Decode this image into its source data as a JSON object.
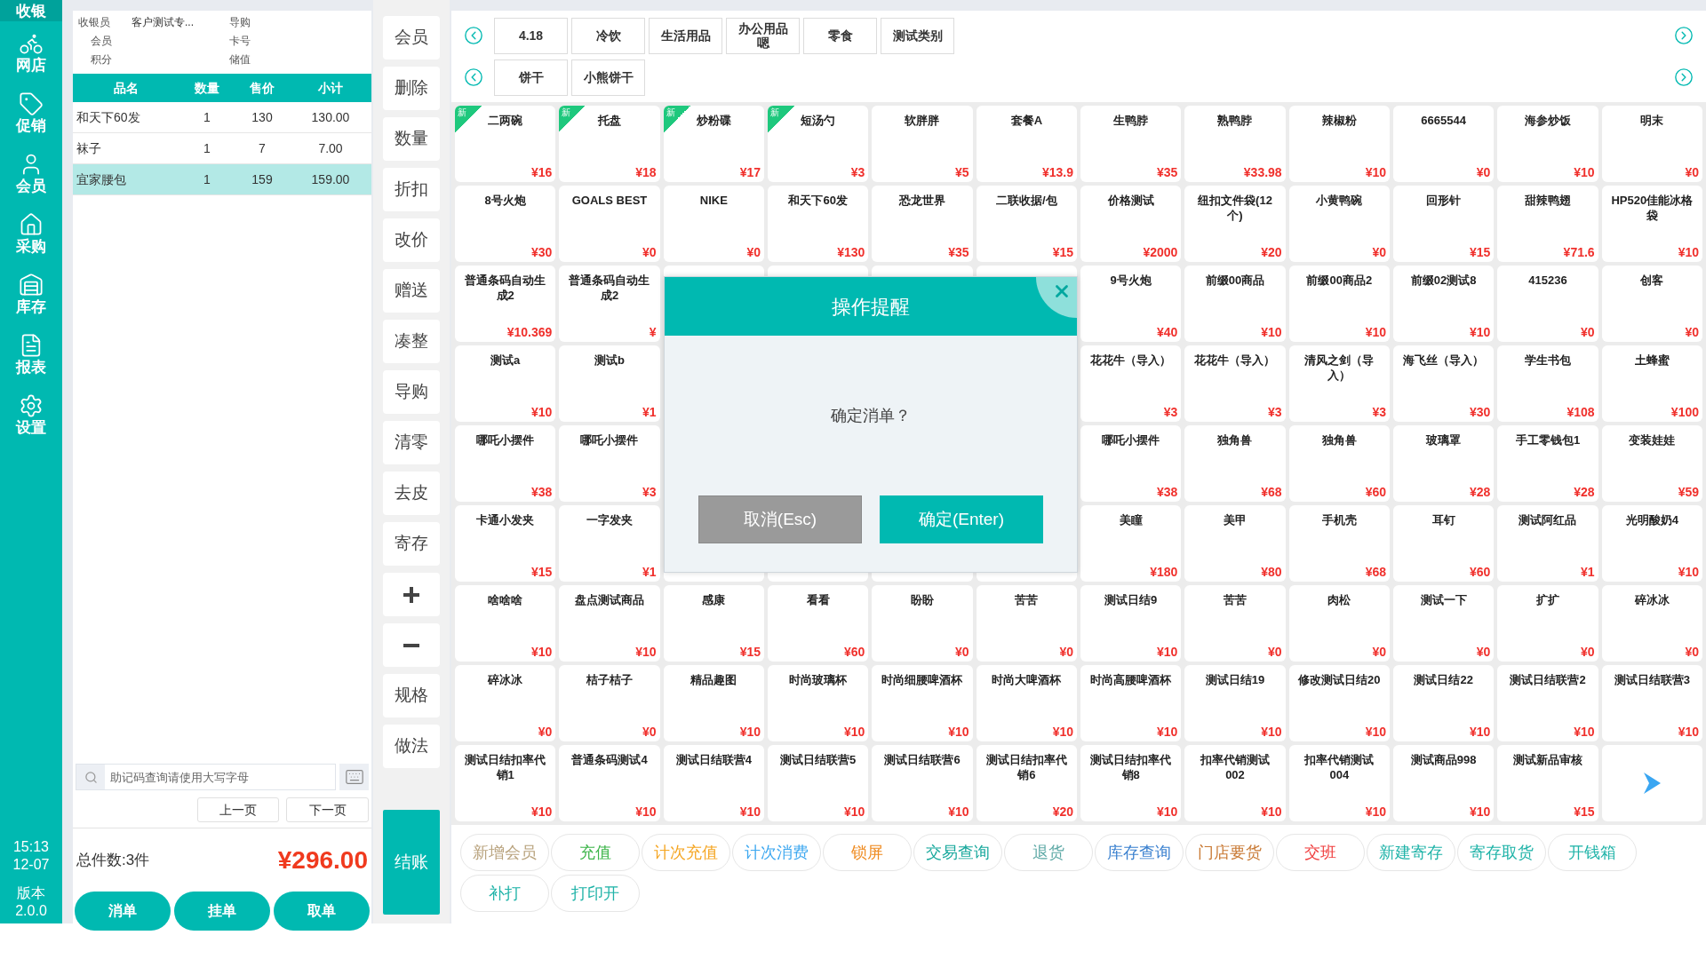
{
  "sidebar": {
    "items": [
      {
        "label": "收银",
        "selected": true
      },
      {
        "label": "网店",
        "selected": false
      },
      {
        "label": "促销",
        "selected": false
      },
      {
        "label": "会员",
        "selected": false
      },
      {
        "label": "采购",
        "selected": false
      },
      {
        "label": "库存",
        "selected": false
      },
      {
        "label": "报表",
        "selected": false
      },
      {
        "label": "设置",
        "selected": false
      }
    ],
    "time": "15:13",
    "date": "12-07",
    "version_label": "版本",
    "version": "2.0.0"
  },
  "order": {
    "info_rows": [
      {
        "left_label": "收银员",
        "left_value": "客户测试专...",
        "right_label": "导购"
      },
      {
        "left_label": "会员",
        "right_label": "卡号"
      },
      {
        "left_label": "积分",
        "right_label": "储值"
      }
    ],
    "columns": [
      "品名",
      "数量",
      "售价",
      "小计"
    ],
    "rows": [
      {
        "name": "和天下60发",
        "qty": "1",
        "price": "130",
        "subtotal": "130.00",
        "selected": false
      },
      {
        "name": "袜子",
        "qty": "1",
        "price": "7",
        "subtotal": "7.00",
        "selected": false
      },
      {
        "name": "宜家腰包",
        "qty": "1",
        "price": "159",
        "subtotal": "159.00",
        "selected": true
      }
    ],
    "search": {
      "placeholder": "助记码查询请使用大写字母"
    },
    "prev_page": "上一页",
    "next_page": "下一页",
    "total_count": "总件数:3件",
    "total_amount": "¥296.00",
    "buttons": [
      "消单",
      "挂单",
      "取单"
    ]
  },
  "functions": [
    {
      "kind": "text",
      "label": "会员"
    },
    {
      "kind": "text",
      "label": "删除"
    },
    {
      "kind": "text",
      "label": "数量"
    },
    {
      "kind": "text",
      "label": "折扣"
    },
    {
      "kind": "text",
      "label": "改价"
    },
    {
      "kind": "text",
      "label": "赠送"
    },
    {
      "kind": "text",
      "label": "凑整"
    },
    {
      "kind": "text",
      "label": "导购"
    },
    {
      "kind": "text",
      "label": "清零"
    },
    {
      "kind": "text",
      "label": "去皮"
    },
    {
      "kind": "text",
      "label": "寄存"
    },
    {
      "kind": "plus"
    },
    {
      "kind": "minus"
    },
    {
      "kind": "text",
      "label": "规格"
    },
    {
      "kind": "text",
      "label": "做法"
    }
  ],
  "checkout": "结账",
  "category_rows": [
    [
      "4.18",
      "冷饮",
      "生活用品",
      "办公用品嗯",
      "零食",
      "测试类别"
    ],
    [
      "饼干",
      "小熊饼干"
    ]
  ],
  "products": [
    {
      "kind": "product",
      "name": "二两碗",
      "price": "¥16",
      "new": true,
      "badge": "新"
    },
    {
      "kind": "product",
      "name": "托盘",
      "price": "¥18",
      "new": true,
      "badge": "新"
    },
    {
      "kind": "product",
      "name": "炒粉碟",
      "price": "¥17",
      "new": true,
      "badge": "新"
    },
    {
      "kind": "product",
      "name": "短汤勺",
      "price": "¥3",
      "new": true,
      "badge": "新"
    },
    {
      "kind": "product",
      "name": "软胖胖",
      "price": "¥5",
      "new": false
    },
    {
      "kind": "product",
      "name": "套餐A",
      "price": "¥13.9",
      "new": false
    },
    {
      "kind": "product",
      "name": "生鸭脖",
      "price": "¥35",
      "new": false
    },
    {
      "kind": "product",
      "name": "熟鸭脖",
      "price": "¥33.98",
      "new": false
    },
    {
      "kind": "product",
      "name": "辣椒粉",
      "price": "¥10",
      "new": false
    },
    {
      "kind": "product",
      "name": "6665544",
      "price": "¥0",
      "new": false
    },
    {
      "kind": "product",
      "name": "海参炒饭",
      "price": "¥10",
      "new": false
    },
    {
      "kind": "product",
      "name": "明末",
      "price": "¥0",
      "new": false
    },
    {
      "kind": "product",
      "name": "8号火炮",
      "price": "¥30",
      "new": false
    },
    {
      "kind": "product",
      "name": "GOALS BEST",
      "price": "¥0",
      "new": false
    },
    {
      "kind": "product",
      "name": "NIKE",
      "price": "¥0",
      "new": false
    },
    {
      "kind": "product",
      "name": "和天下60发",
      "price": "¥130",
      "new": false
    },
    {
      "kind": "product",
      "name": "恐龙世界",
      "price": "¥35",
      "new": false
    },
    {
      "kind": "product",
      "name": "二联收据/包",
      "price": "¥15",
      "new": false
    },
    {
      "kind": "product",
      "name": "价格测试",
      "price": "¥2000",
      "new": false
    },
    {
      "kind": "product",
      "name": "纽扣文件袋(12个)",
      "price": "¥20",
      "new": false
    },
    {
      "kind": "product",
      "name": "小黄鸭碗",
      "price": "¥0",
      "new": false
    },
    {
      "kind": "product",
      "name": "回形针",
      "price": "¥15",
      "new": false
    },
    {
      "kind": "product",
      "name": "甜辣鸭翅",
      "price": "¥71.6",
      "new": false
    },
    {
      "kind": "product",
      "name": "HP520佳能冰格袋",
      "price": "¥10",
      "new": false
    },
    {
      "kind": "product",
      "name": "普通条码自动生成2",
      "price": "¥10.369",
      "new": false
    },
    {
      "kind": "product",
      "name": "普通条码自动生成2",
      "price": "¥",
      "new": false
    },
    {
      "kind": "covered"
    },
    {
      "kind": "covered"
    },
    {
      "kind": "covered"
    },
    {
      "kind": "covered"
    },
    {
      "kind": "product",
      "name": "9号火炮",
      "price": "¥40",
      "new": false
    },
    {
      "kind": "product",
      "name": "前缀00商品",
      "price": "¥10",
      "new": false
    },
    {
      "kind": "product",
      "name": "前缀00商品2",
      "price": "¥10",
      "new": false
    },
    {
      "kind": "product",
      "name": "前缀02测试8",
      "price": "¥10",
      "new": false
    },
    {
      "kind": "product",
      "name": "415236",
      "price": "¥0",
      "new": false
    },
    {
      "kind": "product",
      "name": "创客",
      "price": "¥0",
      "new": false
    },
    {
      "kind": "product",
      "name": "测试a",
      "price": "¥10",
      "new": false
    },
    {
      "kind": "product",
      "name": "测试b",
      "price": "¥1",
      "new": false
    },
    {
      "kind": "hidden"
    },
    {
      "kind": "hidden"
    },
    {
      "kind": "hidden"
    },
    {
      "kind": "hidden"
    },
    {
      "kind": "product",
      "name": "花花牛（导入）",
      "price": "¥3",
      "new": false
    },
    {
      "kind": "product",
      "name": "花花牛（导入）",
      "price": "¥3",
      "new": false
    },
    {
      "kind": "product",
      "name": "清风之剑（导入）",
      "price": "¥3",
      "new": false
    },
    {
      "kind": "product",
      "name": "海飞丝（导入）",
      "price": "¥30",
      "new": false
    },
    {
      "kind": "product",
      "name": "学生书包",
      "price": "¥108",
      "new": false
    },
    {
      "kind": "product",
      "name": "土蜂蜜",
      "price": "¥100",
      "new": false
    },
    {
      "kind": "product",
      "name": "哪吒小摆件",
      "price": "¥38",
      "new": false
    },
    {
      "kind": "product",
      "name": "哪吒小摆件",
      "price": "¥3",
      "new": false
    },
    {
      "kind": "hidden"
    },
    {
      "kind": "hidden"
    },
    {
      "kind": "hidden"
    },
    {
      "kind": "hidden"
    },
    {
      "kind": "product",
      "name": "哪吒小摆件",
      "price": "¥38",
      "new": false
    },
    {
      "kind": "product",
      "name": "独角兽",
      "price": "¥68",
      "new": false
    },
    {
      "kind": "product",
      "name": "独角兽",
      "price": "¥60",
      "new": false
    },
    {
      "kind": "product",
      "name": "玻璃罩",
      "price": "¥28",
      "new": false
    },
    {
      "kind": "product",
      "name": "手工零钱包1",
      "price": "¥28",
      "new": false
    },
    {
      "kind": "product",
      "name": "变装娃娃",
      "price": "¥59",
      "new": false
    },
    {
      "kind": "product",
      "name": "卡通小发夹",
      "price": "¥15",
      "new": false
    },
    {
      "kind": "product",
      "name": "一字发夹",
      "price": "¥1",
      "new": false
    },
    {
      "kind": "covered"
    },
    {
      "kind": "covered"
    },
    {
      "kind": "covered"
    },
    {
      "kind": "covered"
    },
    {
      "kind": "product",
      "name": "美瞳",
      "price": "¥180",
      "new": false
    },
    {
      "kind": "product",
      "name": "美甲",
      "price": "¥80",
      "new": false
    },
    {
      "kind": "product",
      "name": "手机壳",
      "price": "¥68",
      "new": false
    },
    {
      "kind": "product",
      "name": "耳钉",
      "price": "¥60",
      "new": false
    },
    {
      "kind": "product",
      "name": "测试阿红品",
      "price": "¥1",
      "new": false
    },
    {
      "kind": "product",
      "name": "光明酸奶4",
      "price": "¥10",
      "new": false
    },
    {
      "kind": "product",
      "name": "啥啥啥",
      "price": "¥10",
      "new": false
    },
    {
      "kind": "product",
      "name": "盘点测试商品",
      "price": "¥10",
      "new": false
    },
    {
      "kind": "product",
      "name": "感康",
      "price": "¥15",
      "new": false
    },
    {
      "kind": "product",
      "name": "看看",
      "price": "¥60",
      "new": false
    },
    {
      "kind": "product",
      "name": "盼盼",
      "price": "¥0",
      "new": false
    },
    {
      "kind": "product",
      "name": "苦苦",
      "price": "¥0",
      "new": false
    },
    {
      "kind": "product",
      "name": "测试日结9",
      "price": "¥10",
      "new": false
    },
    {
      "kind": "product",
      "name": "苦苦",
      "price": "¥0",
      "new": false
    },
    {
      "kind": "product",
      "name": "肉松",
      "price": "¥0",
      "new": false
    },
    {
      "kind": "product",
      "name": "测试一下",
      "price": "¥0",
      "new": false
    },
    {
      "kind": "product",
      "name": "扩扩",
      "price": "¥0",
      "new": false
    },
    {
      "kind": "product",
      "name": "碎冰冰",
      "price": "¥0",
      "new": false
    },
    {
      "kind": "product",
      "name": "碎冰冰",
      "price": "¥0",
      "new": false
    },
    {
      "kind": "product",
      "name": "桔子桔子",
      "price": "¥0",
      "new": false
    },
    {
      "kind": "product",
      "name": "精品趣图",
      "price": "¥10",
      "new": false
    },
    {
      "kind": "product",
      "name": "时尚玻璃杯",
      "price": "¥10",
      "new": false
    },
    {
      "kind": "product",
      "name": "时尚细腰啤酒杯",
      "price": "¥10",
      "new": false
    },
    {
      "kind": "product",
      "name": "时尚大啤酒杯",
      "price": "¥10",
      "new": false
    },
    {
      "kind": "product",
      "name": "时尚高腰啤酒杯",
      "price": "¥10",
      "new": false
    },
    {
      "kind": "product",
      "name": "测试日结19",
      "price": "¥10",
      "new": false
    },
    {
      "kind": "product",
      "name": "修改测试日结20",
      "price": "¥10",
      "new": false
    },
    {
      "kind": "product",
      "name": "测试日结22",
      "price": "¥10",
      "new": false
    },
    {
      "kind": "product",
      "name": "测试日结联营2",
      "price": "¥10",
      "new": false
    },
    {
      "kind": "product",
      "name": "测试日结联营3",
      "price": "¥10",
      "new": false
    },
    {
      "kind": "product",
      "name": "测试日结扣率代销1",
      "price": "¥10",
      "new": false
    },
    {
      "kind": "product",
      "name": "普通条码测试4",
      "price": "¥10",
      "new": false
    },
    {
      "kind": "product",
      "name": "测试日结联营4",
      "price": "¥10",
      "new": false
    },
    {
      "kind": "product",
      "name": "测试日结联营5",
      "price": "¥10",
      "new": false
    },
    {
      "kind": "product",
      "name": "测试日结联营6",
      "price": "¥10",
      "new": false
    },
    {
      "kind": "product",
      "name": "测试日结扣率代销6",
      "price": "¥20",
      "new": false
    },
    {
      "kind": "product",
      "name": "测试日结扣率代销8",
      "price": "¥10",
      "new": false
    },
    {
      "kind": "product",
      "name": "扣率代销测试002",
      "price": "¥10",
      "new": false
    },
    {
      "kind": "product",
      "name": "扣率代销测试004",
      "price": "¥10",
      "new": false
    },
    {
      "kind": "product",
      "name": "测试商品998",
      "price": "¥10",
      "new": false
    },
    {
      "kind": "product",
      "name": "测试新品审核",
      "price": "¥15",
      "new": false
    },
    {
      "kind": "next"
    }
  ],
  "actions": [
    {
      "label": "新增会员",
      "color": "#b8a27c"
    },
    {
      "label": "充值",
      "color": "#3db54a"
    },
    {
      "label": "计次充值",
      "color": "#f5a623"
    },
    {
      "label": "计次消费",
      "color": "#3ea8f0"
    },
    {
      "label": "锁屏",
      "color": "#ef8a1e"
    },
    {
      "label": "交易查询",
      "color": "#17a89c"
    },
    {
      "label": "退货",
      "color": "#5ea9a6"
    },
    {
      "label": "库存查询",
      "color": "#3a80cf"
    },
    {
      "label": "门店要货",
      "color": "#c97a35"
    },
    {
      "label": "交班",
      "color": "#f03c3c"
    },
    {
      "label": "新建寄存",
      "color": "#1fb3a8"
    },
    {
      "label": "寄存取货",
      "color": "#1fb3a8"
    },
    {
      "label": "开钱箱",
      "color": "#1fb3a8"
    },
    {
      "label": "补打",
      "color": "#1fb3a8"
    },
    {
      "label": "打印开",
      "color": "#1fb3a8"
    }
  ],
  "dialog": {
    "title": "操作提醒",
    "message": "确定消单？",
    "cancel": "取消(Esc)",
    "confirm": "确定(Enter)"
  }
}
